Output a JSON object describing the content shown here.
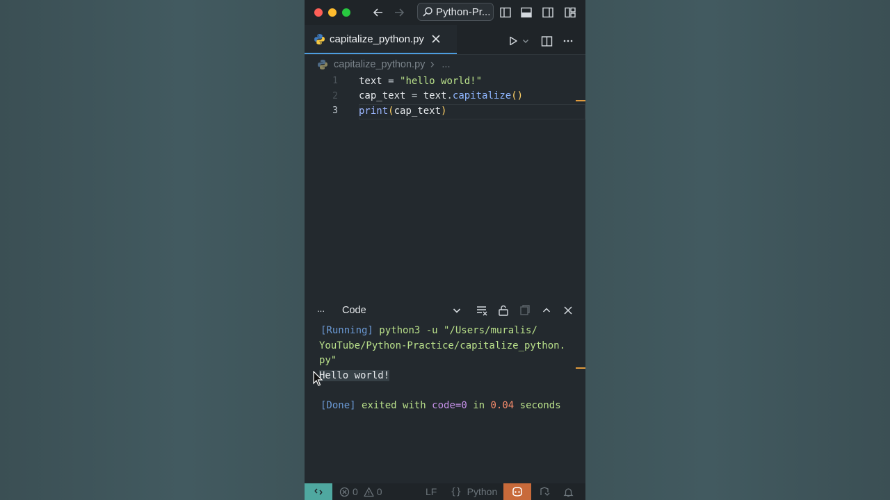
{
  "titlebar": {
    "command_center": "Python-Pr..."
  },
  "tab": {
    "filename": "capitalize_python.py"
  },
  "breadcrumb": {
    "file": "capitalize_python.py",
    "ellipsis": "..."
  },
  "editor": {
    "lines": [
      {
        "number": "1",
        "tokens": [
          {
            "text": "text",
            "cls": "c-id"
          },
          {
            "text": " = ",
            "cls": "c-op"
          },
          {
            "text": "\"hello world!\"",
            "cls": "c-str"
          }
        ]
      },
      {
        "number": "2",
        "tokens": [
          {
            "text": "cap_text",
            "cls": "c-id"
          },
          {
            "text": " = ",
            "cls": "c-op"
          },
          {
            "text": "text",
            "cls": "c-id"
          },
          {
            "text": ".",
            "cls": "c-op"
          },
          {
            "text": "capitalize",
            "cls": "c-fn"
          },
          {
            "text": "()",
            "cls": "c-paren"
          }
        ]
      },
      {
        "number": "3",
        "tokens": [
          {
            "text": "print",
            "cls": "c-kw"
          },
          {
            "text": "(",
            "cls": "c-paren"
          },
          {
            "text": "cap_text",
            "cls": "c-id"
          },
          {
            "text": ")",
            "cls": "c-paren"
          }
        ]
      }
    ]
  },
  "panel": {
    "more": "···",
    "output_channel": "Code"
  },
  "output": {
    "running_tag": "[Running]",
    "running_cmd_1": "python3 -u \"/Users/muralis/",
    "running_cmd_2": "YouTube/Python-Practice/capitalize_python.",
    "running_cmd_3": "py\"",
    "result": "Hello world!",
    "done_tag": "[Done]",
    "exited_with": "exited with",
    "code": "code=0",
    "in": "in",
    "time": "0.04",
    "seconds": "seconds"
  },
  "statusbar": {
    "errors": "0",
    "warnings": "0",
    "eol": "LF",
    "language": "Python"
  },
  "colors": {
    "accent_tab": "#4d9de0",
    "remote": "#4fa8a0",
    "copilot": "#c86a3a"
  }
}
